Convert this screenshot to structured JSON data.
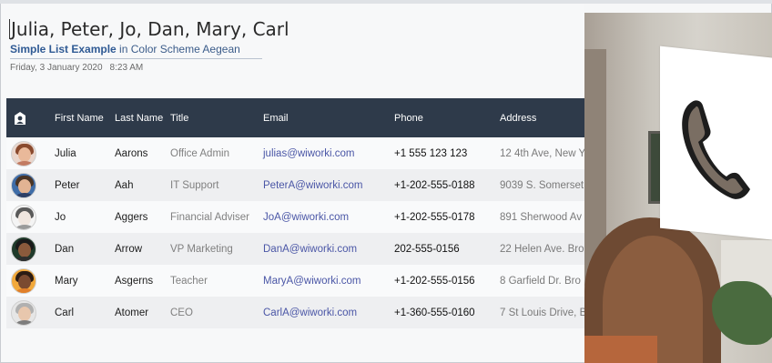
{
  "document": {
    "title": "Julia, Peter, Jo, Dan, Mary, Carl",
    "subtitle_bold": "Simple List Example",
    "subtitle_rest": " in Color Scheme Aegean",
    "date": "Friday, 3 January 2020",
    "time": "8:23 AM"
  },
  "table": {
    "headers": {
      "contact_icon": "contact-card-icon",
      "first": "First Name",
      "last": "Last Name",
      "title": "Title",
      "email": "Email",
      "phone": "Phone",
      "address": "Address"
    },
    "rows": [
      {
        "first": "Julia",
        "last": "Aarons",
        "title": "Office Admin",
        "email": "julias@wiworki.com",
        "phone": "+1 555 123 123",
        "address": "12 4th Ave, New Y"
      },
      {
        "first": "Peter",
        "last": "Aah",
        "title": "IT Support",
        "email": "PeterA@wiworki.com",
        "phone": "+1-202-555-0188",
        "address": "9039 S. Somerset"
      },
      {
        "first": "Jo",
        "last": "Aggers",
        "title": "Financial Adviser",
        "email": "JoA@wiworki.com",
        "phone": "+1-202-555-0178",
        "address": "891 Sherwood Av"
      },
      {
        "first": "Dan",
        "last": "Arrow",
        "title": "VP Marketing",
        "email": "DanA@wiworki.com",
        "phone": "202-555-0156",
        "address": "22 Helen Ave. Bro"
      },
      {
        "first": "Mary",
        "last": "Asgerns",
        "title": "Teacher",
        "email": "MaryA@wiworki.com",
        "phone": "+1-202-555-0156",
        "address": "8 Garfield Dr. Bro"
      },
      {
        "first": "Carl",
        "last": "Atomer",
        "title": "CEO",
        "email": "CarlA@wiworki.com",
        "phone": "+1-360-555-0160",
        "address": "7 St Louis Drive, B"
      }
    ]
  },
  "colors": {
    "header_bg": "#2e3a4a",
    "email_link": "#4a56a6",
    "subtitle_accent": "#2f5a94"
  },
  "overlay": {
    "icon": "phone-icon"
  }
}
